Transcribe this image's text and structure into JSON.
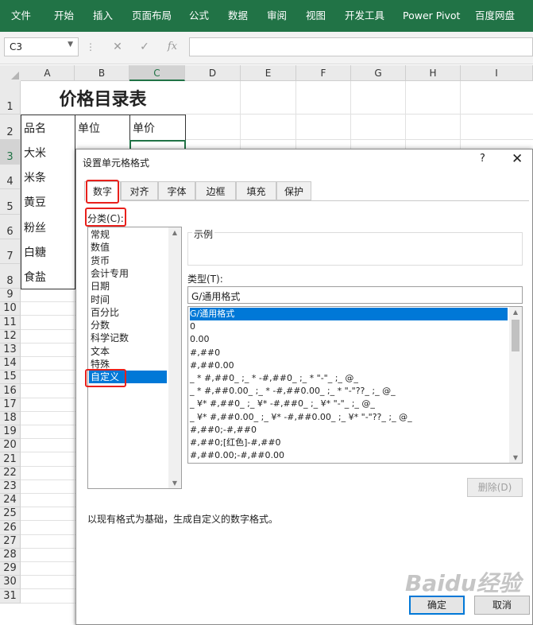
{
  "ribbon": {
    "tabs": [
      "文件",
      "开始",
      "插入",
      "页面布局",
      "公式",
      "数据",
      "审阅",
      "视图",
      "开发工具",
      "Power Pivot",
      "百度网盘"
    ]
  },
  "formula_bar": {
    "name_box": "C3",
    "cancel_icon": "✕",
    "enter_icon": "✓",
    "fx_label": "fx",
    "formula": ""
  },
  "sheet": {
    "columns": [
      "A",
      "B",
      "C",
      "D",
      "E",
      "F",
      "G",
      "H",
      "I"
    ],
    "selected_column": "C",
    "selected_row": "3",
    "rows": [
      "1",
      "2",
      "3",
      "4",
      "5",
      "6",
      "7",
      "8",
      "9",
      "10",
      "11",
      "12",
      "13",
      "14",
      "15",
      "16",
      "17",
      "18",
      "19",
      "20",
      "21",
      "22",
      "23",
      "24",
      "25",
      "26",
      "27",
      "28",
      "29",
      "30",
      "31"
    ],
    "title": "价格目录表",
    "headers": [
      "品名",
      "单位",
      "单价"
    ],
    "items": [
      "大米",
      "米条",
      "黄豆",
      "粉丝",
      "白糖",
      "食盐"
    ]
  },
  "dialog": {
    "title": "设置单元格格式",
    "help": "?",
    "close": "✕",
    "tabs": [
      "数字",
      "对齐",
      "字体",
      "边框",
      "填充",
      "保护"
    ],
    "active_tab": "数字",
    "category_label": "分类(C):",
    "categories": [
      "常规",
      "数值",
      "货币",
      "会计专用",
      "日期",
      "时间",
      "百分比",
      "分数",
      "科学记数",
      "文本",
      "特殊",
      "自定义"
    ],
    "selected_category": "自定义",
    "sample_label": "示例",
    "type_label": "类型(T):",
    "type_value": "G/通用格式",
    "formats": [
      "G/通用格式",
      "0",
      "0.00",
      "#,##0",
      "#,##0.00",
      "_ * #,##0_ ;_ * -#,##0_ ;_ * \"-\"_ ;_ @_ ",
      "_ * #,##0.00_ ;_ * -#,##0.00_ ;_ * \"-\"??_ ;_ @_ ",
      "_ ¥* #,##0_ ;_ ¥* -#,##0_ ;_ ¥* \"-\"_ ;_ @_ ",
      "_ ¥* #,##0.00_ ;_ ¥* -#,##0.00_ ;_ ¥* \"-\"??_ ;_ @_ ",
      "#,##0;-#,##0",
      "#,##0;[红色]-#,##0",
      "#,##0.00;-#,##0.00"
    ],
    "delete_button": "删除(D)",
    "description": "以现有格式为基础，生成自定义的数字格式。",
    "ok_button": "确定",
    "cancel_button": "取消"
  },
  "watermark": "Baidu经验",
  "colors": {
    "ribbon": "#217346",
    "highlight": "#e8201b",
    "selection": "#0078d7"
  }
}
